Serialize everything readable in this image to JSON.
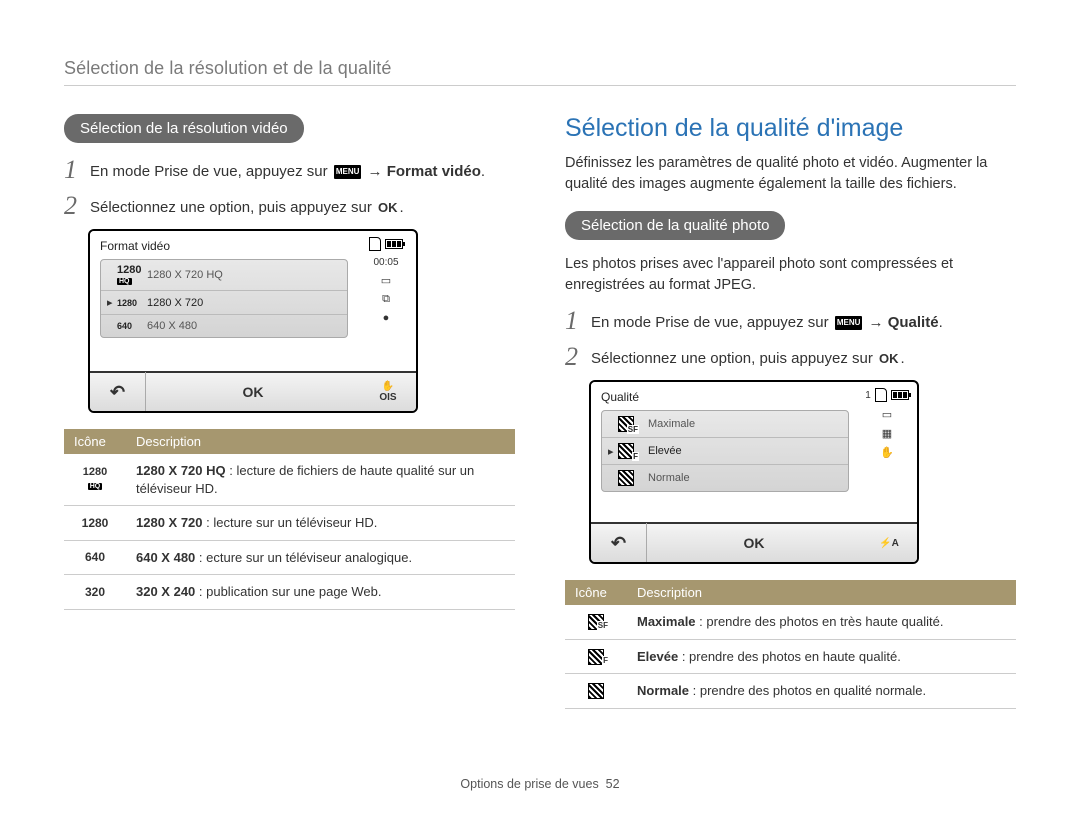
{
  "page": {
    "breadcrumb": "Sélection de la résolution et de la qualité",
    "footer_label": "Options de prise de vues",
    "footer_page": "52"
  },
  "left": {
    "pill": "Sélection de la résolution vidéo",
    "step1_prefix": "En mode Prise de vue, appuyez sur",
    "menu_badge": "MENU",
    "step1_suffix_bold": "→ Format vidéo",
    "step1_period": ".",
    "step2": "Sélectionnez une option, puis appuyez sur",
    "step2_ok": "OK",
    "step2_period": ".",
    "screen": {
      "title": "Format vidéo",
      "timer": "00:05",
      "rows": [
        {
          "icon_top": "1280",
          "icon_bot": "HQ",
          "label": "1280 X 720 HQ",
          "selected": false
        },
        {
          "icon_top": "1280",
          "icon_bot": "",
          "label": "1280 X 720",
          "selected": true
        },
        {
          "icon_top": "640",
          "icon_bot": "",
          "label": "640 X 480",
          "selected": false
        }
      ],
      "back": "↶",
      "ok": "OK",
      "ois": "OIS"
    },
    "table": {
      "h1": "Icône",
      "h2": "Description",
      "rows": [
        {
          "icon_top": "1280",
          "icon_bot": "HQ",
          "bold": "1280 X 720 HQ",
          "rest": " : lecture de fichiers de haute qualité sur un téléviseur HD."
        },
        {
          "icon_top": "1280",
          "icon_bot": "",
          "bold": "1280 X 720",
          "rest": " : lecture sur un téléviseur HD."
        },
        {
          "icon_top": "640",
          "icon_bot": "",
          "bold": "640 X 480",
          "rest": " : ecture sur un téléviseur analogique."
        },
        {
          "icon_top": "320",
          "icon_bot": "",
          "bold": "320 X 240",
          "rest": " : publication sur une page Web."
        }
      ]
    }
  },
  "right": {
    "title": "Sélection de la qualité d'image",
    "intro": "Définissez les paramètres de qualité photo et vidéo. Augmenter la qualité des images augmente également la taille des fichiers.",
    "pill": "Sélection de la qualité photo",
    "subintro": "Les photos prises avec l'appareil photo sont compressées et enregistrées au format JPEG.",
    "step1_prefix": "En mode Prise de vue, appuyez sur",
    "menu_badge": "MENU",
    "step1_suffix_bold": "→ Qualité",
    "step1_period": ".",
    "step2": "Sélectionnez une option, puis appuyez sur",
    "step2_ok": "OK",
    "step2_period": ".",
    "screen": {
      "title": "Qualité",
      "counter": "1",
      "rows": [
        {
          "sub": "SF",
          "label": "Maximale",
          "selected": false
        },
        {
          "sub": "F",
          "label": "Elevée",
          "selected": true
        },
        {
          "sub": "",
          "label": "Normale",
          "selected": false
        }
      ],
      "back": "↶",
      "ok": "OK",
      "flash": "⚡A"
    },
    "table": {
      "h1": "Icône",
      "h2": "Description",
      "rows": [
        {
          "sub": "SF",
          "bold": "Maximale",
          "rest": " : prendre des photos en très haute qualité."
        },
        {
          "sub": "F",
          "bold": "Elevée",
          "rest": " : prendre des photos en haute qualité."
        },
        {
          "sub": "",
          "bold": "Normale",
          "rest": " : prendre des photos en qualité normale."
        }
      ]
    }
  }
}
